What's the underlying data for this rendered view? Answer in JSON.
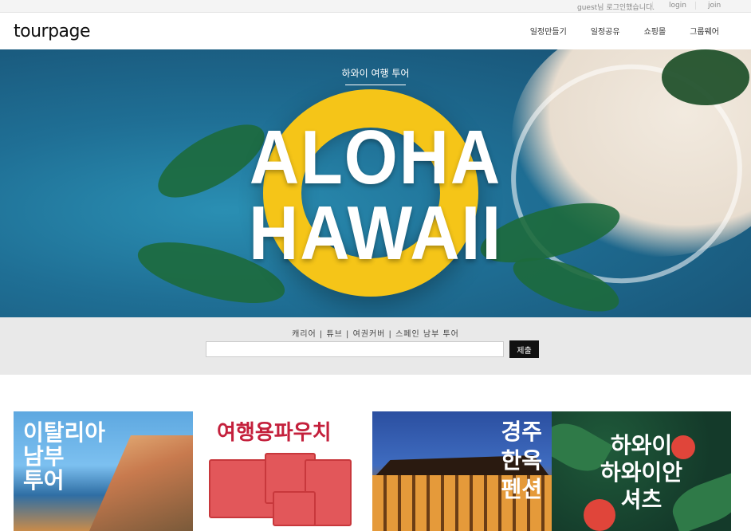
{
  "topbar": {
    "message": "guest님 로그인했습니다.",
    "login": "login",
    "join": "join"
  },
  "header": {
    "logo": "tourpage",
    "nav": [
      "일정만들기",
      "일정공유",
      "쇼핑몰",
      "그룹웨어"
    ]
  },
  "hero": {
    "subtitle": "하와이 여행 투어",
    "line1": "ALOHA",
    "line2": "HAWAII"
  },
  "search": {
    "keywords": "캐리어 | 튜브 | 여권커버 | 스페인 남부 투어",
    "input_value": "",
    "button": "제출"
  },
  "cards": [
    {
      "title": "이탈리아 남부 투어",
      "lines": [
        "이탈리아",
        "남부",
        "투어"
      ]
    },
    {
      "title": "여행용파우치",
      "lines": [
        "여행용파우치"
      ]
    },
    {
      "title": "경주 한옥 펜션",
      "lines": [
        "경주",
        "한옥",
        "펜션"
      ]
    },
    {
      "title": "하와이 하와이안 셔츠",
      "lines": [
        "하와이",
        "하와이안",
        "셔츠"
      ]
    }
  ],
  "colors": {
    "accent": "#111111",
    "pouch_red": "#c4203c",
    "ring_yellow": "#f5c518"
  }
}
